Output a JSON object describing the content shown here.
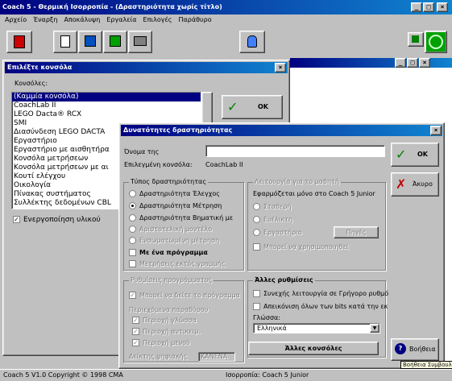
{
  "app": {
    "title": "Coach 5 - Θερμική Ισορροπία - (Δραστηριότητα χωρίς τίτλο)",
    "status": "Coach 5 V1.0 Copyright © 1998 CMA",
    "status2": "Ισορροπία: Coach 5 Junior"
  },
  "menu": [
    "Αρχείο",
    "Έναρξη",
    "Αποκάλυψη",
    "Εργαλεία",
    "Επιλογές",
    "Παράθυρο"
  ],
  "panel": {
    "title": "Επιλέξτε κονσόλα",
    "label": "Κονσόλες:",
    "ok": "ΟΚ",
    "enable": "Ενεργοποίηση υλικού",
    "items": [
      "(Καμμία κονσόλα)",
      "CoachLab II",
      "LEGO Dacta® RCX",
      "SMI",
      "Διασύνδεση LEGO DACTA",
      "Εργαστήριο",
      "Εργαστήριο με αισθητήρα",
      "Κονσόλα μετρήσεων",
      "Κονσόλα μετρήσεων με αι",
      "Κουτί ελέγχου",
      "Οικολογία",
      "Πίνακας συστήματος",
      "Συλλέκτης δεδομένων CBL"
    ]
  },
  "dialog": {
    "title": "Δυνατότητες δραστηριότητας",
    "name_label": "Όνομα της",
    "name_value": "",
    "console_label": "Επιλεγμένη κονσόλα:",
    "console_value": "CoachLab II",
    "ok": "ΟΚ",
    "cancel": "Άκυρο",
    "help": "Βοήθεια",
    "help_tip": "Βοήθεια Συμβουλές",
    "type_title": "Τύπος δραστηριότητας",
    "types": [
      "Δραστηριότητα Έλεγχος",
      "Δραστηριότητα Μέτρηση",
      "Δραστηριότητα Βηματική με",
      "Αριστοτελική μοντέλο",
      "Ενσωματωμένη μέτρηση"
    ],
    "one_program": "Με ένα πρόγραμμα",
    "offline": "Μετρήσεις εκτός γραμμής",
    "student_title": "Λειτουργία για το μαθητή",
    "student_note": "Εφαρμόζεται μόνο στο Coach 5 Junior",
    "student_opts": [
      "Σταθερή",
      "Ευέλικτη",
      "Εργαστήριο"
    ],
    "student_btn": "Πηγές",
    "student_chk": "Μπορεί να χρησιμοποιηθεί",
    "prog_title": "Ρυθμίσεις προγράμματος",
    "prog_chk": "Μπορεί να δείτε το πρόγραμμα",
    "params_title": "Περιεχόμενα παραθύρου",
    "params": [
      "Περιοχή γλώσσα",
      "Περιοχή αντικειμ.",
      "Περιοχή μενού"
    ],
    "digit_label": "Δείκτης ψηφιακής",
    "digit_value": "ΚΑΝΕΝΑ",
    "other_title": "Άλλες ρυθμίσεις",
    "other_chk": [
      "Συνεχής λειτουργία σε Γρήγορο ρυθμό",
      "Απεικόνιση όλων των bits κατά την εκ"
    ],
    "lang_label": "Γλώσσα:",
    "lang_value": "Ελληνικά",
    "other_btn": "Άλλες κονσόλες"
  }
}
